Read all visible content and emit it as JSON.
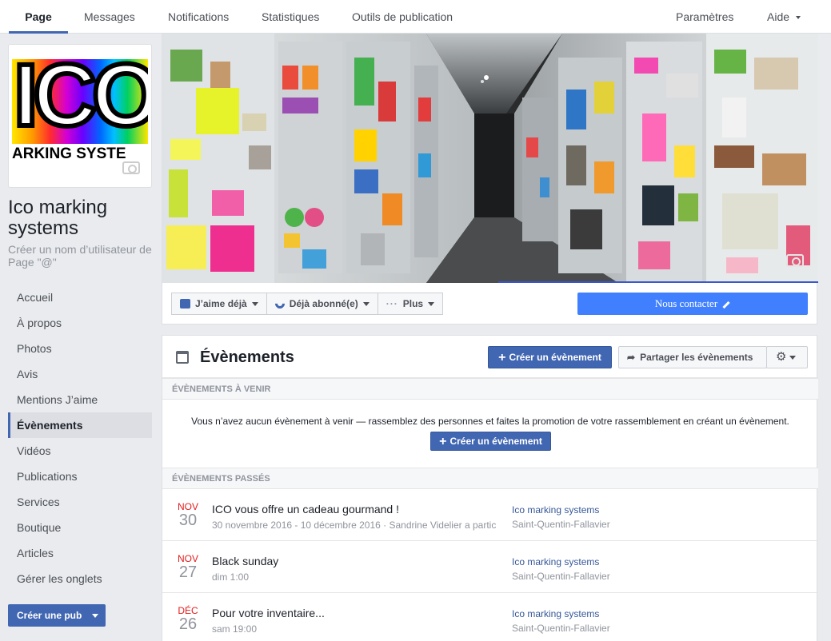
{
  "topnav": {
    "tabs": [
      {
        "label": "Page"
      },
      {
        "label": "Messages"
      },
      {
        "label": "Notifications"
      },
      {
        "label": "Statistiques"
      },
      {
        "label": "Outils de publication"
      }
    ],
    "settings": "Paramètres",
    "help": "Aide"
  },
  "profile": {
    "logo_text": "ICO",
    "logo_sub": "ARKING SYSTE",
    "name": "Ico marking systems",
    "username_prompt": "Créer un nom d’utilisateur de Page \"@\""
  },
  "leftnav": {
    "items": [
      {
        "label": "Accueil"
      },
      {
        "label": "À propos"
      },
      {
        "label": "Photos"
      },
      {
        "label": "Avis"
      },
      {
        "label": "Mentions J’aime"
      },
      {
        "label": "Évènements"
      },
      {
        "label": "Vidéos"
      },
      {
        "label": "Publications"
      },
      {
        "label": "Services"
      },
      {
        "label": "Boutique"
      },
      {
        "label": "Articles"
      },
      {
        "label": "Gérer les onglets"
      }
    ],
    "active": "Évènements",
    "create_ad": "Créer une pub"
  },
  "actions": {
    "liked": "J’aime déjà",
    "subscribed": "Déjà abonné(e)",
    "more": "Plus",
    "contact": "Nous contacter"
  },
  "events": {
    "title": "Évènements",
    "create": "Créer un évènement",
    "share": "Partager les évènements",
    "upcoming_header": "Évènements à venir",
    "empty_text": "Vous n’avez aucun évènement à venir — rassemblez des personnes et faites la promotion de votre rassemblement en créant un évènement.",
    "create_inline": "Créer un évènement",
    "past_header": "Évènements passés",
    "past": [
      {
        "month": "NOV",
        "day": "30",
        "name": "ICO vous offre un cadeau gourmand !",
        "date": "30 novembre 2016 - 10 décembre 2016 · Sandrine Videlier a partic",
        "organizer": "Ico marking systems",
        "location": "Saint-Quentin-Fallavier"
      },
      {
        "month": "NOV",
        "day": "27",
        "name": "Black sunday",
        "date": "dim 1:00",
        "organizer": "Ico marking systems",
        "location": "Saint-Quentin-Fallavier"
      },
      {
        "month": "DÉC",
        "day": "26",
        "name": "Pour votre inventaire...",
        "date": "sam 19:00",
        "organizer": "Ico marking systems",
        "location": "Saint-Quentin-Fallavier"
      }
    ]
  },
  "colors": {
    "brand": "#4267b2",
    "contact": "#4080ff",
    "month_red": "#e41a1a",
    "link": "#365899"
  }
}
